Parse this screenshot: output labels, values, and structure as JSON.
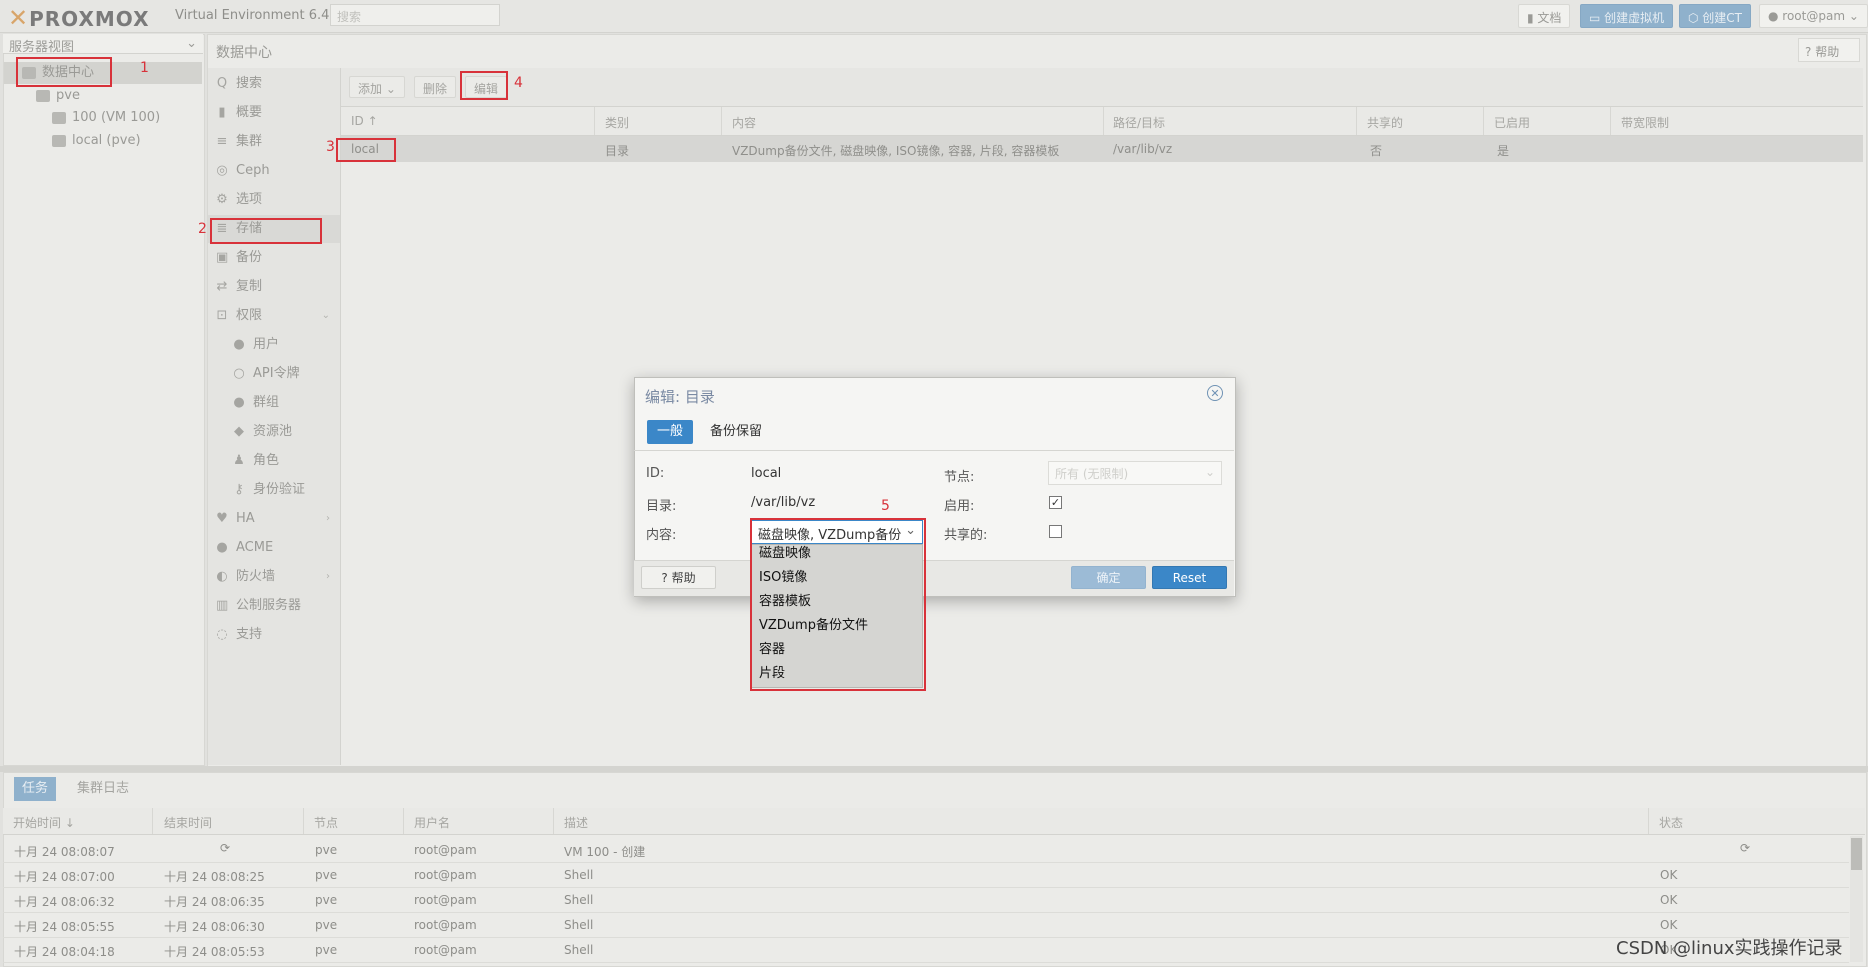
{
  "topbar": {
    "logo_text": "PROXMOX",
    "version": "Virtual Environment 6.4-4",
    "search_placeholder": "搜索",
    "docs_label": "文档",
    "create_vm_label": "创建虚拟机",
    "create_ct_label": "创建CT",
    "user_label": "root@pam"
  },
  "tree": {
    "view_label": "服务器视图",
    "datacenter": "数据中心",
    "node": "pve",
    "vm": "100 (VM 100)",
    "storage": "local (pve)"
  },
  "dc": {
    "title": "数据中心",
    "help_label": "帮助"
  },
  "nav": [
    {
      "label": "搜索",
      "icon": "Q"
    },
    {
      "label": "概要",
      "icon": "▮"
    },
    {
      "label": "集群",
      "icon": "≡"
    },
    {
      "label": "Ceph",
      "icon": "◎"
    },
    {
      "label": "选项",
      "icon": "⚙"
    },
    {
      "label": "存储",
      "icon": "≣"
    },
    {
      "label": "备份",
      "icon": "▣"
    },
    {
      "label": "复制",
      "icon": "⇄"
    },
    {
      "label": "权限",
      "icon": "🔓"
    },
    {
      "label": "用户",
      "icon": "●"
    },
    {
      "label": "API令牌",
      "icon": "○"
    },
    {
      "label": "群组",
      "icon": "●"
    },
    {
      "label": "资源池",
      "icon": "◆"
    },
    {
      "label": "角色",
      "icon": "♟"
    },
    {
      "label": "身份验证",
      "icon": "⚷"
    },
    {
      "label": "HA",
      "icon": "♥"
    },
    {
      "label": "ACME",
      "icon": "●"
    },
    {
      "label": "防火墙",
      "icon": "◐"
    },
    {
      "label": "公制服务器",
      "icon": "▥"
    },
    {
      "label": "支持",
      "icon": "◌"
    }
  ],
  "storage_toolbar": {
    "add_label": "添加",
    "remove_label": "删除",
    "edit_label": "编辑"
  },
  "storage_columns": [
    "ID ↑",
    "类别",
    "内容",
    "路径/目标",
    "共享的",
    "已启用",
    "带宽限制"
  ],
  "storage_rows": [
    {
      "id": "local",
      "type": "目录",
      "content": "VZDump备份文件, 磁盘映像, ISO镜像, 容器, 片段, 容器模板",
      "path": "/var/lib/vz",
      "shared": "否",
      "enabled": "是",
      "bwlimit": ""
    }
  ],
  "annotations": [
    "1",
    "2",
    "3",
    "4",
    "5"
  ],
  "tasks": {
    "tab_tasks": "任务",
    "tab_cluster_log": "集群日志",
    "columns": [
      "开始时间 ↓",
      "结束时间",
      "节点",
      "用户名",
      "描述",
      "状态"
    ],
    "rows": [
      {
        "start": "十月 24 08:08:07",
        "end": "",
        "node": "pve",
        "user": "root@pam",
        "desc": "VM 100 - 创建",
        "status": ""
      },
      {
        "start": "十月 24 08:07:00",
        "end": "十月 24 08:08:25",
        "node": "pve",
        "user": "root@pam",
        "desc": "Shell",
        "status": "OK"
      },
      {
        "start": "十月 24 08:06:32",
        "end": "十月 24 08:06:35",
        "node": "pve",
        "user": "root@pam",
        "desc": "Shell",
        "status": "OK"
      },
      {
        "start": "十月 24 08:05:55",
        "end": "十月 24 08:06:30",
        "node": "pve",
        "user": "root@pam",
        "desc": "Shell",
        "status": "OK"
      },
      {
        "start": "十月 24 08:04:18",
        "end": "十月 24 08:05:53",
        "node": "pve",
        "user": "root@pam",
        "desc": "Shell",
        "status": "OK"
      }
    ]
  },
  "dialog": {
    "title": "编辑: 目录",
    "tab_general": "一般",
    "tab_backup": "备份保留",
    "id_label": "ID:",
    "id_value": "local",
    "dir_label": "目录:",
    "dir_value": "/var/lib/vz",
    "content_label": "内容:",
    "content_value": "磁盘映像, VZDump备份",
    "node_label": "节点:",
    "node_placeholder": "所有 (无限制)",
    "enabled_label": "启用:",
    "enabled_checked": true,
    "shared_label": "共享的:",
    "shared_checked": false,
    "help_label": "帮助",
    "ok_label": "确定",
    "reset_label": "Reset",
    "content_options": [
      "磁盘映像",
      "ISO镜像",
      "容器模板",
      "VZDump备份文件",
      "容器",
      "片段"
    ]
  },
  "watermark": "CSDN @linux实践操作记录",
  "colors": {
    "accent": "#3b87c8",
    "annotation_red": "#d8323a"
  }
}
